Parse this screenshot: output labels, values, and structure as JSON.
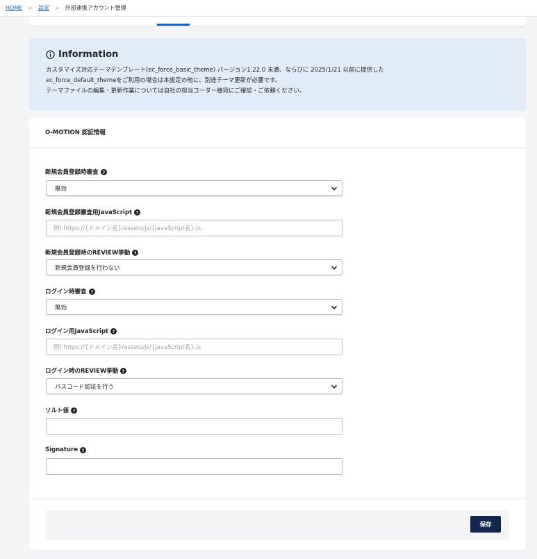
{
  "breadcrumb": {
    "home": "HOME",
    "separator": ">",
    "settings": "設定",
    "current": "外部連携アカウント管理"
  },
  "info": {
    "title": "Information",
    "lines": [
      "カスタマイズ対応テーマテンプレート(ec_force_basic_theme) バージョン1.22.0 未満、ならびに 2025/1/21 以前に提供した",
      "ec_force_default_themeをご利用の場合は本設定の他に、別途テーマ更新が必要です。",
      "テーマファイルの編集・更新作業については自社の担当コーダー様宛にご確認・ご依頼ください。"
    ]
  },
  "form": {
    "section_title": "O-MOTION 認証情報",
    "fields": [
      {
        "label": "新規会員登録時審査",
        "type": "select",
        "value": "無効"
      },
      {
        "label": "新規会員登録審査用JavaScript",
        "type": "text",
        "value": "",
        "placeholder": "例) https://{ドメイン名}/assets/js/{JavaScript名}.js"
      },
      {
        "label": "新規会員登録時のREVIEW挙動",
        "type": "select",
        "value": "新規会員登録を行わない"
      },
      {
        "label": "ログイン時審査",
        "type": "select",
        "value": "無効"
      },
      {
        "label": "ログイン用JavaScript",
        "type": "text",
        "value": "",
        "placeholder": "例) https://{ドメイン名}/assets/js/{JavaScript名}.js"
      },
      {
        "label": "ログイン時のREVIEW挙動",
        "type": "select",
        "value": "パスコード認証を行う"
      },
      {
        "label": "ソルト値",
        "type": "text",
        "value": "",
        "placeholder": ""
      },
      {
        "label": "Signature",
        "type": "text",
        "value": "",
        "placeholder": ""
      }
    ],
    "save_label": "保存"
  },
  "icons": {
    "info": "info-circle-icon",
    "help": "question-circle-icon",
    "dropdown": "chevron-down-icon"
  },
  "colors": {
    "accent": "#1565d8",
    "info_background": "#e1ecf8",
    "primary_button": "#12264f"
  }
}
